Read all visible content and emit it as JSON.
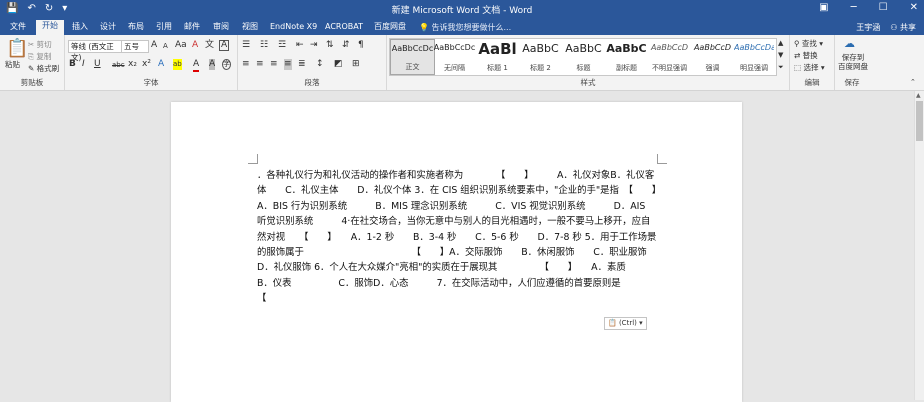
{
  "window": {
    "title": "新建 Microsoft Word 文档 - Word",
    "minimize_icon": "─",
    "maximize_icon": "☐",
    "close_icon": "✕",
    "ribbon_display_icon": "▣"
  },
  "quick_access": {
    "save": "💾",
    "undo": "↶",
    "redo": "↻",
    "more": "▾"
  },
  "tabs": [
    "文件",
    "开始",
    "插入",
    "设计",
    "布局",
    "引用",
    "邮件",
    "审阅",
    "视图",
    "EndNote X9",
    "ACROBAT",
    "百度网盘"
  ],
  "tell_me": "告诉我您想要做什么...",
  "user": {
    "name": "王宇涵",
    "share": "共享"
  },
  "clipboard": {
    "paste": "粘贴",
    "cut": "剪切",
    "copy": "复制",
    "format_painter": "格式刷",
    "label": "剪贴板"
  },
  "font": {
    "name": "等线 (西文正文)",
    "size": "五号",
    "label": "字体",
    "grow": "A",
    "shrink": "A",
    "case": "Aa",
    "clear": "A",
    "phonetic": "文",
    "border": "A",
    "bold": "B",
    "italic": "I",
    "underline": "U",
    "strike": "abc",
    "sub": "x₂",
    "sup": "x²",
    "effects": "A",
    "highlight": "ab",
    "color": "A",
    "shading": "A",
    "enclose": "字"
  },
  "paragraph": {
    "label": "段落"
  },
  "styles": {
    "label": "样式",
    "items": [
      {
        "sample": "AaBbCcDc",
        "name": "正文"
      },
      {
        "sample": "AaBbCcDc",
        "name": "无间隔"
      },
      {
        "sample": "AaBl",
        "name": "标题 1"
      },
      {
        "sample": "AaBbC",
        "name": "标题 2"
      },
      {
        "sample": "AaBbC",
        "name": "标题"
      },
      {
        "sample": "AaBbC",
        "name": "副标题"
      },
      {
        "sample": "AaBbCcD",
        "name": "不明显强调"
      },
      {
        "sample": "AaBbCcD",
        "name": "强调"
      },
      {
        "sample": "AaBbCcDa",
        "name": "明显强调"
      }
    ]
  },
  "editing": {
    "label": "编辑",
    "find": "查找",
    "replace": "替换",
    "select": "选择"
  },
  "save_group": {
    "label": "保存",
    "button_line1": "保存到",
    "button_line2": "百度网盘"
  },
  "document": {
    "text": "．各种礼仪行为和礼仪活动的操作者和实施者称为　　　　【　　】　　　A．礼仪对象B．礼仪客体　　C．礼仪主体　　D．礼仪个体 3．在 CIS 组织识别系统要素中，\"企业的手\"是指　【　　】　　　A．BIS 行为识别系统　　　B．MIS 理念识别系统　　　C．VIS 视觉识别系统　　　D．AIS 听觉识别系统　　　4·在社交场合，当你无意中与别人的目光相遇时，一般不要马上移开，应自然对视　　【　　】　　A．1-2 秒　　B．3-4 秒　　C．5-6 秒　　D．7-8 秒 5．用于工作场景的服饰属于　　　　　　　　　　　　【　　】A．交际服饰　　B．休闲服饰　　C．职业服饰　　D．礼仪服饰 6．个人在大众媒介\"亮相\"的实质在于展现其　　　　　【　　】　　A．素质　　B．仪表　　　　　C．服饰D．心态　　　7．在交际活动中，人们应遵循的首要原则是　　　　　　【",
    "paste_options": "(Ctrl)"
  }
}
